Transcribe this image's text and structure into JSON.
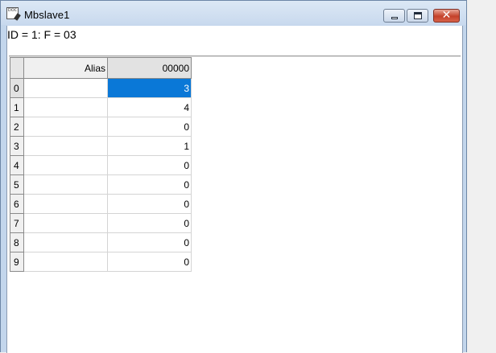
{
  "window": {
    "title": "Mbslave1",
    "icon": "document-icon",
    "controls": [
      "minimize",
      "maximize",
      "close"
    ]
  },
  "header": {
    "text": "ID = 1: F = 03"
  },
  "grid": {
    "columns": [
      "",
      "Alias",
      "00000"
    ],
    "rows": [
      {
        "index": "0",
        "alias": "",
        "value": "3"
      },
      {
        "index": "1",
        "alias": "",
        "value": "4"
      },
      {
        "index": "2",
        "alias": "",
        "value": "0"
      },
      {
        "index": "3",
        "alias": "",
        "value": "1"
      },
      {
        "index": "4",
        "alias": "",
        "value": "0"
      },
      {
        "index": "5",
        "alias": "",
        "value": "0"
      },
      {
        "index": "6",
        "alias": "",
        "value": "0"
      },
      {
        "index": "7",
        "alias": "",
        "value": "0"
      },
      {
        "index": "8",
        "alias": "",
        "value": "0"
      },
      {
        "index": "9",
        "alias": "",
        "value": "0"
      }
    ],
    "selected_row": 0,
    "selected_color": "#0a78d7"
  }
}
